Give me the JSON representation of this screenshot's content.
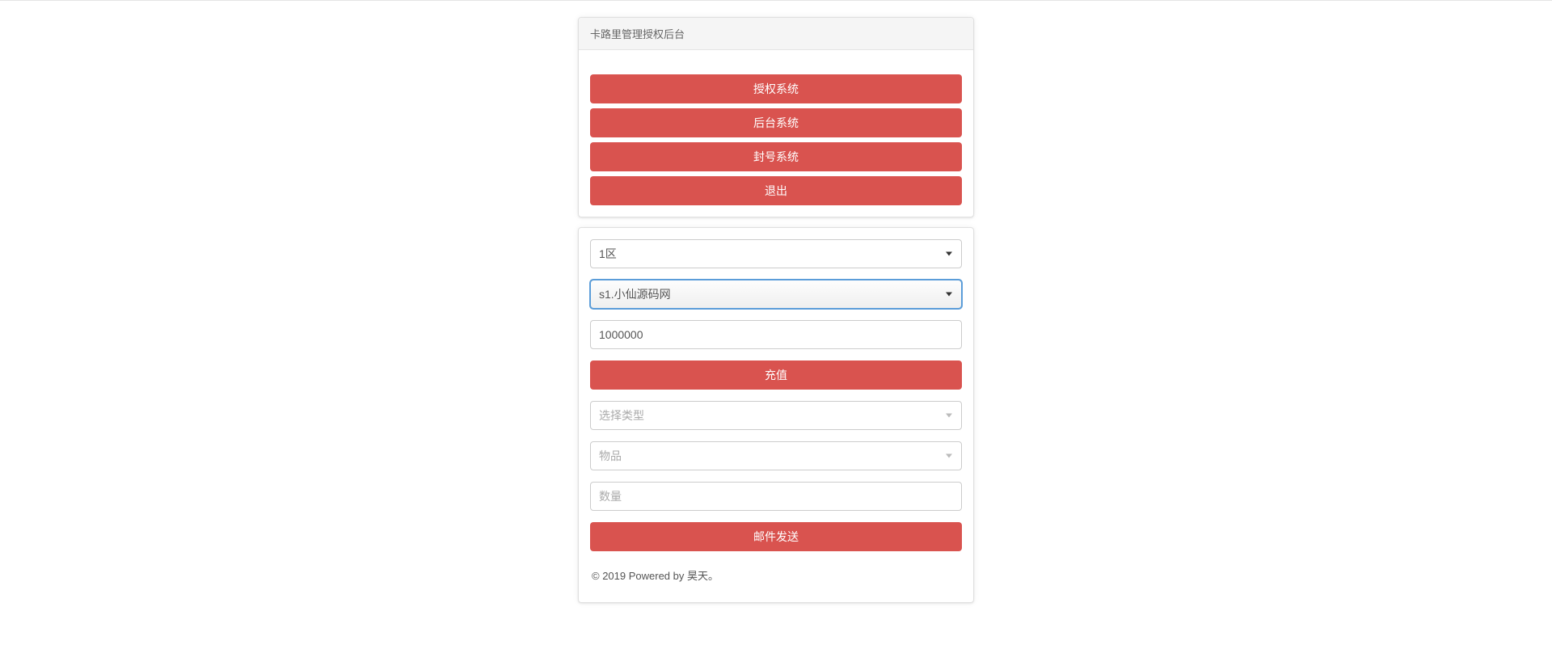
{
  "header": {
    "title": "卡路里管理授权后台"
  },
  "nav": {
    "buttons": [
      {
        "label": "授权系统"
      },
      {
        "label": "后台系统"
      },
      {
        "label": "封号系统"
      },
      {
        "label": "退出"
      }
    ]
  },
  "form": {
    "region_select": {
      "value": "1区"
    },
    "server_select": {
      "value": "s1.小仙源码网"
    },
    "amount_input": {
      "value": "1000000"
    },
    "recharge_button": "充值",
    "type_select": {
      "placeholder": "选择类型"
    },
    "item_select": {
      "placeholder": "物品"
    },
    "quantity_input": {
      "placeholder": "数量"
    },
    "mail_button": "邮件发送"
  },
  "footer": {
    "text": "© 2019 Powered by 昊天。"
  }
}
